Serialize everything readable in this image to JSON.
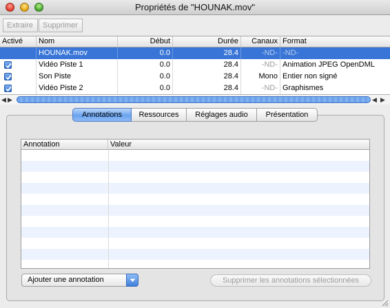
{
  "window": {
    "title": "Propriétés de \"HOUNAK.mov\""
  },
  "toolbar": {
    "extract_label": "Extraire",
    "delete_label": "Supprimer"
  },
  "tracks": {
    "columns": [
      "Activé",
      "Nom",
      "Début",
      "Durée",
      "Canaux",
      "Format"
    ],
    "rows": [
      {
        "enabled": null,
        "name": "HOUNAK.mov",
        "start": "0.0",
        "duration": "28.4",
        "channels": "-ND-",
        "format": "-ND-"
      },
      {
        "enabled": true,
        "name": "Vidéo Piste 1",
        "start": "0.0",
        "duration": "28.4",
        "channels": "-ND-",
        "format": "Animation JPEG OpenDML"
      },
      {
        "enabled": true,
        "name": "Son Piste",
        "start": "0.0",
        "duration": "28.4",
        "channels": "Mono",
        "format": "Entier non signé"
      },
      {
        "enabled": true,
        "name": "Vidéo Piste 2",
        "start": "0.0",
        "duration": "28.4",
        "channels": "-ND-",
        "format": "Graphismes"
      }
    ],
    "selected_row": 0
  },
  "tabs": [
    "Annotations",
    "Ressources",
    "Réglages audio",
    "Présentation"
  ],
  "active_tab": 0,
  "annotations": {
    "columns": [
      "Annotation",
      "Valeur"
    ],
    "add_popup_label": "Ajouter une annotation",
    "delete_button_label": "Supprimer les annotations sélectionnées"
  },
  "icons": {
    "close": "close-icon",
    "minimize": "minimize-icon",
    "zoom": "zoom-icon",
    "checkbox": "checkmark-icon",
    "popup_arrow": "chevron-down-icon"
  },
  "colors": {
    "selection": "#3875d7",
    "accent": "#6aa3ef"
  }
}
